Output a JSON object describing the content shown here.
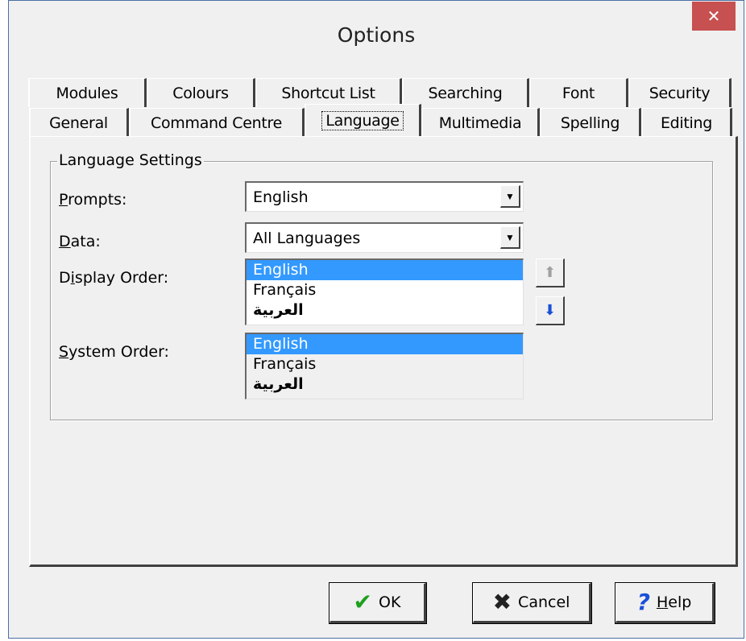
{
  "window": {
    "title": "Options",
    "close_glyph": "✕"
  },
  "tabs": {
    "row1": [
      {
        "label": "Modules"
      },
      {
        "label": "Colours"
      },
      {
        "label": "Shortcut List"
      },
      {
        "label": "Searching"
      },
      {
        "label": "Font"
      },
      {
        "label": "Security"
      }
    ],
    "row2": [
      {
        "label": "General"
      },
      {
        "label": "Command Centre"
      },
      {
        "label": "Language"
      },
      {
        "label": "Multimedia"
      },
      {
        "label": "Spelling"
      },
      {
        "label": "Editing"
      }
    ],
    "active": "Language"
  },
  "language_settings": {
    "group_label": "Language Settings",
    "prompts": {
      "label_first": "P",
      "label_rest": "rompts:",
      "value": "English"
    },
    "data": {
      "label_first": "D",
      "label_rest": "ata:",
      "value": "All Languages"
    },
    "display_order": {
      "label_pre": "D",
      "label_underlined": "i",
      "label_post": "splay Order:",
      "items": [
        "English",
        "Français",
        "العربية"
      ],
      "selected": "English"
    },
    "system_order": {
      "label_first": "S",
      "label_rest": "ystem Order:",
      "items": [
        "English",
        "Français",
        "العربية"
      ],
      "selected": "English"
    },
    "move_up_icon": "arrow-up-icon",
    "move_down_icon": "arrow-down-icon"
  },
  "buttons": {
    "ok": {
      "label": "OK",
      "icon": "checkmark-icon"
    },
    "cancel": {
      "label": "Cancel",
      "icon": "x-icon"
    },
    "help": {
      "label_first": "H",
      "label_rest": "elp",
      "icon": "question-icon"
    }
  },
  "colors": {
    "selection": "#3399ff",
    "close_button": "#c75050",
    "ok_icon": "#1ea01e",
    "cancel_icon": "#222222",
    "help_icon": "#1a4fd8",
    "down_arrow": "#1a4fd8"
  }
}
